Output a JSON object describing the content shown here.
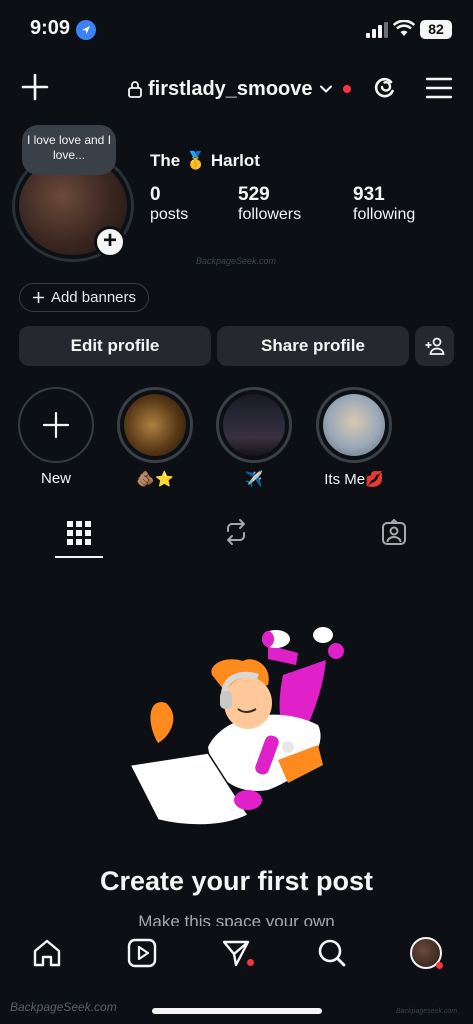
{
  "status_bar": {
    "time": "9:09",
    "battery": "82"
  },
  "header": {
    "username": "firstlady_smoove"
  },
  "profile": {
    "note": "I love love and I love...",
    "display_name": "The 🥇 Harlot",
    "stats": [
      {
        "value": "0",
        "label": "posts"
      },
      {
        "value": "529",
        "label": "followers"
      },
      {
        "value": "931",
        "label": "following"
      }
    ],
    "watermark": "BackpageSeek.com",
    "add_banners": "Add banners"
  },
  "buttons": {
    "edit": "Edit profile",
    "share": "Share profile"
  },
  "highlights": [
    {
      "label": "New"
    },
    {
      "label": "🫵🏽⭐"
    },
    {
      "label": "✈️"
    },
    {
      "label": "Its Me💋"
    }
  ],
  "empty_state": {
    "title": "Create your first post",
    "subtitle": "Make this space your own"
  },
  "footer_watermark": {
    "left": "BackpageSeek.com",
    "right": "Backpageseek.com"
  },
  "colors": {
    "background": "#0c1014",
    "button": "#25292f",
    "notification": "#ff3040",
    "illustration_pink": "#e020c8",
    "illustration_orange": "#ff8a1e"
  }
}
